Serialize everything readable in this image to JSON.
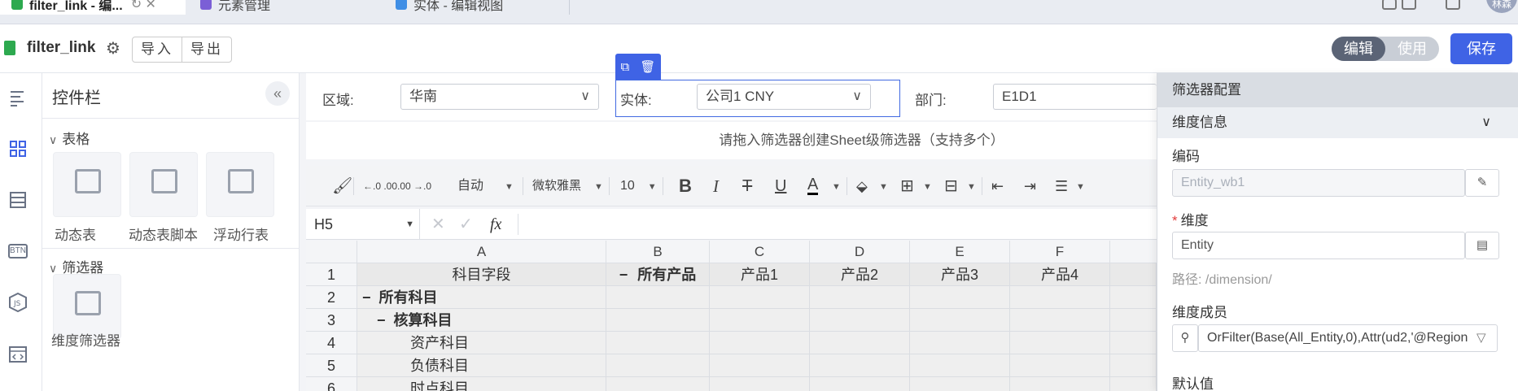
{
  "tabs": [
    {
      "title": "filter_link - 编...",
      "close": "↻ ✕"
    },
    {
      "title": "元素管理"
    },
    {
      "title": "实体 - 编辑视图"
    }
  ],
  "avatar_text": "林森",
  "doc": {
    "title": "filter_link",
    "import_label": "导入",
    "export_label": "导出",
    "mode_edit": "编辑",
    "mode_use": "使用",
    "save_label": "保存"
  },
  "widgets": {
    "header": "控件栏",
    "collapse_icon": "«",
    "section_table": "表格",
    "section_filter": "筛选器",
    "items": [
      {
        "label": "动态表",
        "icon": "table-layout-icon"
      },
      {
        "label": "动态表脚本",
        "icon": "code-brackets-icon"
      },
      {
        "label": "浮动行表",
        "icon": "float-row-icon"
      },
      {
        "label": "维度筛选器",
        "icon": "dimension-filter-icon"
      }
    ]
  },
  "filters": [
    {
      "label": "区域:",
      "value": "华南"
    },
    {
      "label": "实体:",
      "value": "公司1 CNY"
    },
    {
      "label": "部门:",
      "value": "E1D1"
    }
  ],
  "hint": "请拖入筛选器创建Sheet级筛选器（支持多个）",
  "toolbar": {
    "auto": "自动",
    "font": "微软雅黑",
    "size": "10"
  },
  "formula": {
    "cell_ref": "H5",
    "fx": "fx"
  },
  "grid": {
    "columns": [
      "A",
      "B",
      "C",
      "D",
      "E",
      "F"
    ],
    "rows": [
      "1",
      "2",
      "3",
      "4",
      "5",
      "6"
    ],
    "header_row": [
      "科目字段",
      "所有产品",
      "产品1",
      "产品2",
      "产品3",
      "产品4"
    ],
    "b1_prefix": "−",
    "cells": [
      {
        "text": "所有科目",
        "prefix": "−"
      },
      {
        "text": "核算科目",
        "prefix": "−"
      },
      {
        "text": "资产科目"
      },
      {
        "text": "负债科目"
      },
      {
        "text": "时点科目"
      }
    ]
  },
  "config": {
    "title": "筛选器配置",
    "section": "维度信息",
    "code_label": "编码",
    "code_value": "Entity_wb1",
    "dim_label": "维度",
    "dim_required": "*",
    "dim_value": "Entity",
    "path": "路径: /dimension/",
    "members_label": "维度成员",
    "members_value": "OrFilter(Base(All_Entity,0),Attr(ud2,'@Region",
    "default_label": "默认值"
  },
  "colors": {
    "primary": "#3f63e5",
    "toggle_active": "#5b6476",
    "required": "#e23b3b"
  }
}
